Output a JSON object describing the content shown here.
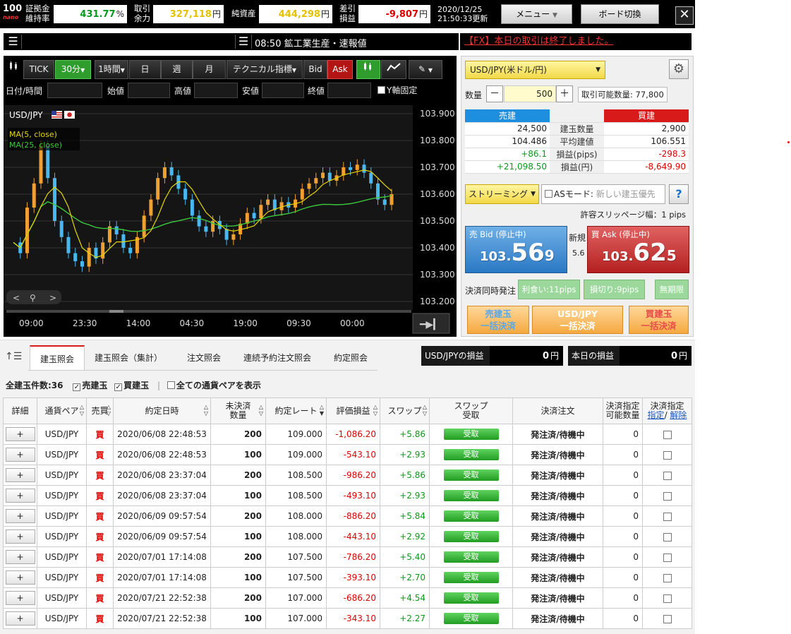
{
  "topbar": {
    "logo_num": "100",
    "logo_sub": "nano",
    "stats": [
      {
        "label1": "証拠金",
        "label2": "維持率",
        "value": "431.77",
        "unit": "%",
        "color": "green"
      },
      {
        "label1": "取引",
        "label2": "余力",
        "value": "327,118",
        "unit": "円",
        "color": "yellow"
      },
      {
        "label1": "純資産",
        "label2": "",
        "value": "444,298",
        "unit": "円",
        "color": "yellow"
      },
      {
        "label1": "差引",
        "label2": "損益",
        "value": "-9,807",
        "unit": "円",
        "color": "red"
      }
    ],
    "date": "2020/12/25",
    "time_update": "21:50:33更新",
    "menu_label": "メニュー",
    "board_label": "ボード切換",
    "close_label": "✕"
  },
  "news": {
    "headline": "08:50 鉱工業生産・速報値",
    "notice": "【FX】本日の取引は終了しました。"
  },
  "chart_toolbar": {
    "tick": "TICK",
    "m30": "30分",
    "h1": "1時間",
    "day": "日",
    "week": "週",
    "month": "月",
    "indicators": "テクニカル指標",
    "bid": "Bid",
    "ask": "Ask",
    "fields": {
      "datetime": "日付/時間",
      "open": "始値",
      "high": "高値",
      "low": "安値",
      "close": "終値",
      "yfix": "Y軸固定"
    }
  },
  "chart_data": {
    "type": "candlestick",
    "pair": "USD/JPY",
    "legend": [
      "MA(5, close)",
      "MA(25, close)"
    ],
    "ylim": [
      103.2,
      103.9
    ],
    "y_ticks": [
      "103.900",
      "103.800",
      "103.700",
      "103.600",
      "103.500",
      "103.400",
      "103.300",
      "103.200"
    ],
    "x_ticks": [
      "09:00",
      "23:30",
      "14:00",
      "04:30",
      "19:00",
      "09:30",
      "00:00"
    ],
    "close_series": [
      103.42,
      103.38,
      103.55,
      103.64,
      103.78,
      103.66,
      103.5,
      103.44,
      103.38,
      103.35,
      103.33,
      103.4,
      103.36,
      103.42,
      103.48,
      103.45,
      103.4,
      103.38,
      103.44,
      103.52,
      103.58,
      103.66,
      103.7,
      103.67,
      103.62,
      103.58,
      103.52,
      103.48,
      103.46,
      103.5,
      103.47,
      103.43,
      103.45,
      103.49,
      103.53,
      103.51,
      103.56,
      103.58,
      103.54,
      103.57,
      103.55,
      103.58,
      103.62,
      103.64,
      103.66,
      103.68,
      103.65,
      103.67,
      103.7,
      103.69,
      103.71,
      103.68,
      103.64,
      103.58,
      103.56,
      103.6
    ],
    "colors": {
      "up": "#f0a030",
      "down": "#4ab8f0",
      "ma5": "#e6d800",
      "ma25": "#3cc83c"
    }
  },
  "trade": {
    "pair_select": "USD/JPY(米ドル/円)",
    "qty_label": "数量",
    "qty_minus": "－",
    "qty_value": "500",
    "qty_plus": "＋",
    "available": "取引可能数量: 77,800",
    "sell_header": "売建",
    "buy_header": "買建",
    "rows": [
      {
        "left": "24,500",
        "label": "建玉数量",
        "right": "2,900",
        "lc": "",
        "rc": ""
      },
      {
        "left": "104.486",
        "label": "平均建値",
        "right": "106.551",
        "lc": "",
        "rc": ""
      },
      {
        "left": "+86.1",
        "label": "損益(pips)",
        "right": "-298.3",
        "lc": "green",
        "rc": "red"
      },
      {
        "left": "+21,098.50",
        "label": "損益(円)",
        "right": "-8,649.90",
        "lc": "green",
        "rc": "red"
      }
    ],
    "stream_select": "ストリーミング",
    "as_mode_label": "ASモード:",
    "as_mode_placeholder": "新しい建玉優先",
    "help": "?",
    "slippage": "許容スリッページ幅：1 pips",
    "bid_label": "売 Bid (停止中)",
    "bid_a": "103.",
    "bid_b": "56",
    "bid_c": "9",
    "spread_label": "新規",
    "spread_value": "5.6",
    "ask_label": "買 Ask (停止中)",
    "ask_a": "103.",
    "ask_b": "62",
    "ask_c": "5",
    "kessai_label": "決済同時発注",
    "take_profit": "利食い:11pips",
    "stop_loss": "損切り:9pips",
    "unlimited": "無期限",
    "bulk_sell_1": "売建玉",
    "bulk_sell_2": "一括決済",
    "bulk_pair_1": "USD/JPY",
    "bulk_pair_2": "一括決済",
    "bulk_buy_1": "買建玉",
    "bulk_buy_2": "一括決済"
  },
  "bottom": {
    "tabs": [
      "建玉照会",
      "建玉照会（集計）",
      "注文照会",
      "連続予約注文照会",
      "約定照会"
    ],
    "pair_pnl_label": "USD/JPYの損益",
    "pair_pnl_value": "0",
    "today_pnl_label": "本日の損益",
    "today_pnl_value": "0",
    "yen": "円",
    "total_count": "全建玉件数:36",
    "filter_sell": "売建玉",
    "filter_buy": "買建玉",
    "filter_all": "全ての通貨ペアを表示",
    "headers": {
      "detail": "詳細",
      "pair": "通貨ペア",
      "side": "売買",
      "date": "約定日時",
      "unsettled1": "未決済",
      "unsettled2": "数量",
      "rate": "約定レート",
      "pnl": "評価損益",
      "swap": "スワップ",
      "swap_recv1": "スワップ",
      "swap_recv2": "受取",
      "settle": "決済注文",
      "settle_qty1": "決済指定",
      "settle_qty2": "可能数量",
      "settle_spec1": "決済指定",
      "settle_spec2a": "指定",
      "settle_spec2b": "解除"
    },
    "rows": [
      {
        "detail": "+",
        "pair": "USD/JPY",
        "side": "買",
        "date": "2020/06/08 22:48:53",
        "qty": "200",
        "rate": "109.000",
        "pnl": "-1,086.20",
        "swap": "+5.86",
        "recv": "受取",
        "status": "発注済/待機中",
        "avail": "0"
      },
      {
        "detail": "+",
        "pair": "USD/JPY",
        "side": "買",
        "date": "2020/06/08 22:48:53",
        "qty": "100",
        "rate": "109.000",
        "pnl": "-543.10",
        "swap": "+2.93",
        "recv": "受取",
        "status": "発注済/待機中",
        "avail": "0"
      },
      {
        "detail": "+",
        "pair": "USD/JPY",
        "side": "買",
        "date": "2020/06/08 23:37:04",
        "qty": "200",
        "rate": "108.500",
        "pnl": "-986.20",
        "swap": "+5.86",
        "recv": "受取",
        "status": "発注済/待機中",
        "avail": "0"
      },
      {
        "detail": "+",
        "pair": "USD/JPY",
        "side": "買",
        "date": "2020/06/08 23:37:04",
        "qty": "100",
        "rate": "108.500",
        "pnl": "-493.10",
        "swap": "+2.93",
        "recv": "受取",
        "status": "発注済/待機中",
        "avail": "0"
      },
      {
        "detail": "+",
        "pair": "USD/JPY",
        "side": "買",
        "date": "2020/06/09 09:57:54",
        "qty": "200",
        "rate": "108.000",
        "pnl": "-886.20",
        "swap": "+5.84",
        "recv": "受取",
        "status": "発注済/待機中",
        "avail": "0"
      },
      {
        "detail": "+",
        "pair": "USD/JPY",
        "side": "買",
        "date": "2020/06/09 09:57:54",
        "qty": "100",
        "rate": "108.000",
        "pnl": "-443.10",
        "swap": "+2.92",
        "recv": "受取",
        "status": "発注済/待機中",
        "avail": "0"
      },
      {
        "detail": "+",
        "pair": "USD/JPY",
        "side": "買",
        "date": "2020/07/01 17:14:08",
        "qty": "200",
        "rate": "107.500",
        "pnl": "-786.20",
        "swap": "+5.40",
        "recv": "受取",
        "status": "発注済/待機中",
        "avail": "0"
      },
      {
        "detail": "+",
        "pair": "USD/JPY",
        "side": "買",
        "date": "2020/07/01 17:14:08",
        "qty": "100",
        "rate": "107.500",
        "pnl": "-393.10",
        "swap": "+2.70",
        "recv": "受取",
        "status": "発注済/待機中",
        "avail": "0"
      },
      {
        "detail": "+",
        "pair": "USD/JPY",
        "side": "買",
        "date": "2020/07/21 22:52:38",
        "qty": "200",
        "rate": "107.000",
        "pnl": "-686.20",
        "swap": "+4.54",
        "recv": "受取",
        "status": "発注済/待機中",
        "avail": "0"
      },
      {
        "detail": "+",
        "pair": "USD/JPY",
        "side": "買",
        "date": "2020/07/21 22:52:38",
        "qty": "100",
        "rate": "107.000",
        "pnl": "-343.10",
        "swap": "+2.27",
        "recv": "受取",
        "status": "発注済/待機中",
        "avail": "0"
      }
    ]
  }
}
